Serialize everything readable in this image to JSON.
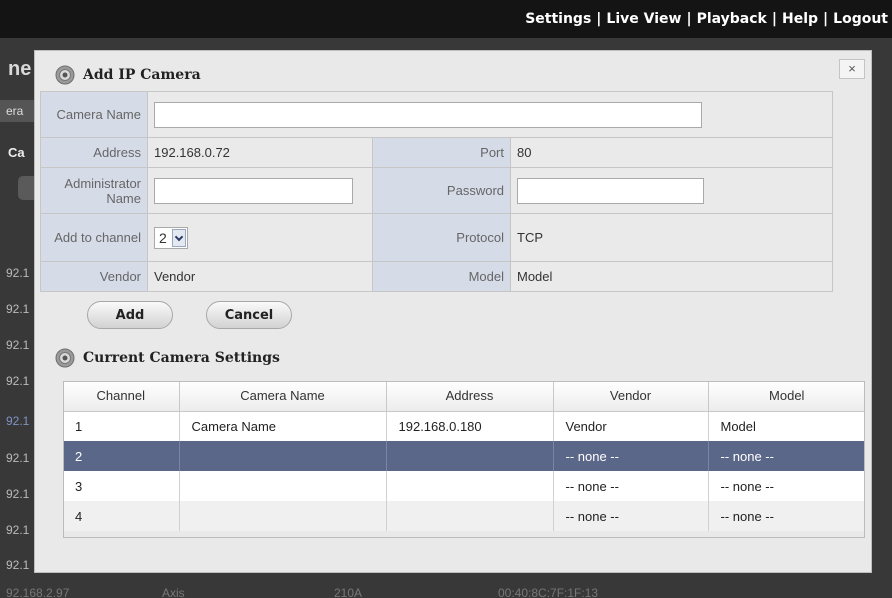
{
  "topnav": [
    "Settings",
    "Live View",
    "Playback",
    "Help",
    "Logout"
  ],
  "background": {
    "title_fragment": "ne",
    "subtab_fragment": "era",
    "label_fragment": "Ca",
    "row_fragments": [
      "92.1",
      "92.1",
      "92.1",
      "92.1",
      "92.1",
      "92.1",
      "92.1",
      "92.1",
      "92.1"
    ],
    "bottom_row": [
      "92.168.2.97",
      "Axis",
      "210A",
      "00:40:8C:7F:1F:13"
    ]
  },
  "dialog": {
    "title": "Add IP Camera",
    "close_label": "×",
    "form": {
      "camera_name_label": "Camera Name",
      "camera_name_value": "",
      "address_label": "Address",
      "address_value": "192.168.0.72",
      "port_label": "Port",
      "port_value": "80",
      "admin_name_label": "Administrator Name",
      "admin_name_value": "",
      "password_label": "Password",
      "password_value": "",
      "channel_label": "Add to channel",
      "channel_value": "2",
      "protocol_label": "Protocol",
      "protocol_value": "TCP",
      "vendor_label": "Vendor",
      "vendor_value": "Vendor",
      "model_label": "Model",
      "model_value": "Model"
    },
    "add_label": "Add",
    "cancel_label": "Cancel",
    "current_title": "Current Camera Settings",
    "table": {
      "headers": [
        "Channel",
        "Camera Name",
        "Address",
        "Vendor",
        "Model"
      ],
      "rows": [
        [
          "1",
          "Camera Name",
          "192.168.0.180",
          "Vendor",
          "Model"
        ],
        [
          "2",
          "",
          "",
          "-- none --",
          "-- none --"
        ],
        [
          "3",
          "",
          "",
          "-- none --",
          "-- none --"
        ],
        [
          "4",
          "",
          "",
          "-- none --",
          "-- none --"
        ]
      ],
      "selected_row": 1
    }
  },
  "colors": {
    "topbar": "#141414",
    "label_cell": "#d6dbe8",
    "selected_row": "#5b6789"
  }
}
